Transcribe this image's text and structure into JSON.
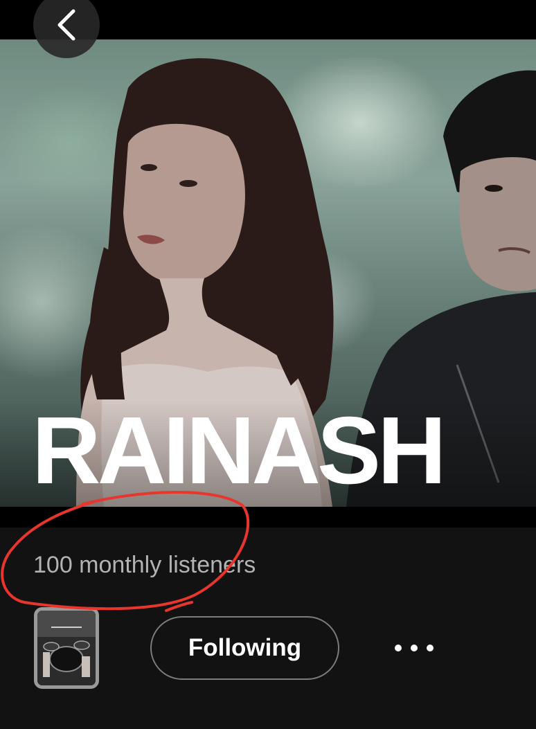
{
  "nav": {
    "back_icon": "chevron-left-icon"
  },
  "artist": {
    "name": "RAINASH",
    "monthly_listeners": "100 monthly listeners"
  },
  "actions": {
    "follow_label": "Following",
    "more_icon": "more-horizontal-icon"
  },
  "annotation": {
    "color": "#e8352e"
  },
  "colors": {
    "background": "#121212",
    "text_secondary": "#b3b3b3",
    "button_border": "#7c7c7c"
  }
}
